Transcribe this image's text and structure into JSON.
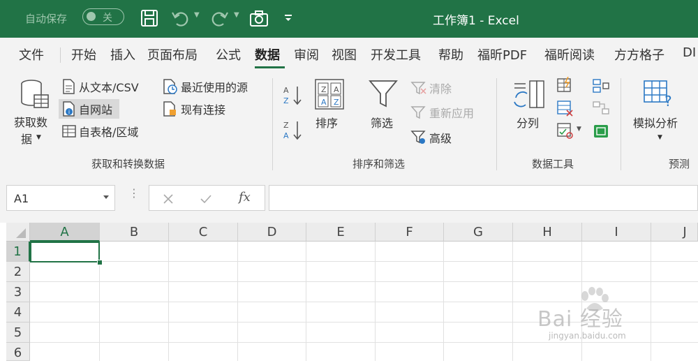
{
  "titlebar": {
    "autosave_label": "自动保存",
    "autosave_toggle": "关",
    "title": "工作簿1 - Excel",
    "color": "#217346"
  },
  "tabs": [
    "文件",
    "开始",
    "插入",
    "页面布局",
    "公式",
    "数据",
    "审阅",
    "视图",
    "开发工具",
    "帮助",
    "福昕PDF",
    "福昕阅读",
    "方方格子",
    "DI"
  ],
  "active_tab": "数据",
  "ribbon": {
    "get_data": {
      "big_button": "获取数据",
      "big_button_line1": "获取数",
      "big_button_line2": "据",
      "from_text_csv": "从文本/CSV",
      "from_web": "自网站",
      "from_table": "自表格/区域",
      "recent_sources": "最近使用的源",
      "existing_connections": "现有连接",
      "group_label": "获取和转换数据"
    },
    "sort_filter": {
      "sort": "排序",
      "filter": "筛选",
      "clear": "清除",
      "reapply": "重新应用",
      "advanced": "高级",
      "group_label": "排序和筛选"
    },
    "data_tools": {
      "text_to_columns": "分列",
      "group_label": "数据工具"
    },
    "forecast": {
      "what_if": "模拟分析",
      "group_label": "预测"
    }
  },
  "formula_bar": {
    "name_box": "A1",
    "fx": "fx",
    "formula": ""
  },
  "grid": {
    "columns": [
      "A",
      "B",
      "C",
      "D",
      "E",
      "F",
      "G",
      "H",
      "I",
      "J"
    ],
    "rows": [
      "1",
      "2",
      "3",
      "4",
      "5",
      "6"
    ],
    "selected_cell": "A1"
  },
  "watermark": {
    "text": "Bai 经验",
    "url": "jingyan.baidu.com"
  }
}
